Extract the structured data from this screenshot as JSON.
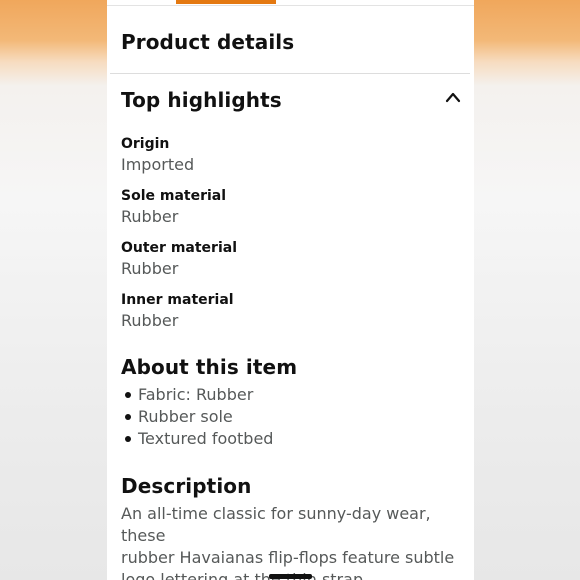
{
  "product_details": {
    "title": "Product details"
  },
  "top_highlights": {
    "title": "Top highlights",
    "items": [
      {
        "label": "Origin",
        "value": "Imported"
      },
      {
        "label": "Sole material",
        "value": "Rubber"
      },
      {
        "label": "Outer material",
        "value": "Rubber"
      },
      {
        "label": "Inner material",
        "value": "Rubber"
      }
    ]
  },
  "about": {
    "title": "About this item",
    "bullets": [
      "Fabric: Rubber",
      "Rubber sole",
      "Textured footbed"
    ]
  },
  "description": {
    "title": "Description",
    "lines": [
      "An all-time classic for sunny-day wear, these",
      "rubber Havaianas flip-flops feature subtle",
      "logo lettering at the thin strap."
    ]
  },
  "colors": {
    "accent": "#e47911",
    "text_primary": "#111111",
    "text_secondary": "#565959"
  },
  "icons": {
    "collapse": "chevron-up-icon"
  }
}
